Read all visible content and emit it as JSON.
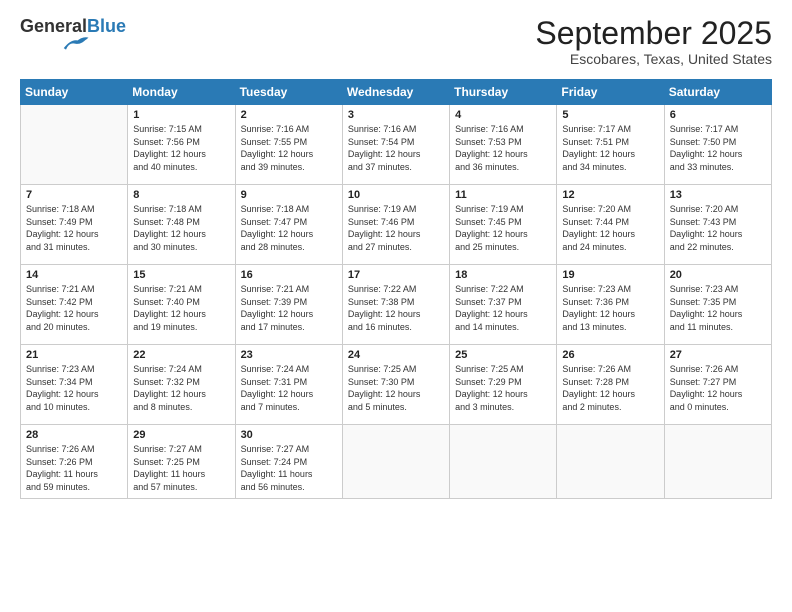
{
  "header": {
    "logo_general": "General",
    "logo_blue": "Blue",
    "month": "September 2025",
    "location": "Escobares, Texas, United States"
  },
  "weekdays": [
    "Sunday",
    "Monday",
    "Tuesday",
    "Wednesday",
    "Thursday",
    "Friday",
    "Saturday"
  ],
  "weeks": [
    [
      {
        "day": "",
        "content": ""
      },
      {
        "day": "1",
        "content": "Sunrise: 7:15 AM\nSunset: 7:56 PM\nDaylight: 12 hours\nand 40 minutes."
      },
      {
        "day": "2",
        "content": "Sunrise: 7:16 AM\nSunset: 7:55 PM\nDaylight: 12 hours\nand 39 minutes."
      },
      {
        "day": "3",
        "content": "Sunrise: 7:16 AM\nSunset: 7:54 PM\nDaylight: 12 hours\nand 37 minutes."
      },
      {
        "day": "4",
        "content": "Sunrise: 7:16 AM\nSunset: 7:53 PM\nDaylight: 12 hours\nand 36 minutes."
      },
      {
        "day": "5",
        "content": "Sunrise: 7:17 AM\nSunset: 7:51 PM\nDaylight: 12 hours\nand 34 minutes."
      },
      {
        "day": "6",
        "content": "Sunrise: 7:17 AM\nSunset: 7:50 PM\nDaylight: 12 hours\nand 33 minutes."
      }
    ],
    [
      {
        "day": "7",
        "content": "Sunrise: 7:18 AM\nSunset: 7:49 PM\nDaylight: 12 hours\nand 31 minutes."
      },
      {
        "day": "8",
        "content": "Sunrise: 7:18 AM\nSunset: 7:48 PM\nDaylight: 12 hours\nand 30 minutes."
      },
      {
        "day": "9",
        "content": "Sunrise: 7:18 AM\nSunset: 7:47 PM\nDaylight: 12 hours\nand 28 minutes."
      },
      {
        "day": "10",
        "content": "Sunrise: 7:19 AM\nSunset: 7:46 PM\nDaylight: 12 hours\nand 27 minutes."
      },
      {
        "day": "11",
        "content": "Sunrise: 7:19 AM\nSunset: 7:45 PM\nDaylight: 12 hours\nand 25 minutes."
      },
      {
        "day": "12",
        "content": "Sunrise: 7:20 AM\nSunset: 7:44 PM\nDaylight: 12 hours\nand 24 minutes."
      },
      {
        "day": "13",
        "content": "Sunrise: 7:20 AM\nSunset: 7:43 PM\nDaylight: 12 hours\nand 22 minutes."
      }
    ],
    [
      {
        "day": "14",
        "content": "Sunrise: 7:21 AM\nSunset: 7:42 PM\nDaylight: 12 hours\nand 20 minutes."
      },
      {
        "day": "15",
        "content": "Sunrise: 7:21 AM\nSunset: 7:40 PM\nDaylight: 12 hours\nand 19 minutes."
      },
      {
        "day": "16",
        "content": "Sunrise: 7:21 AM\nSunset: 7:39 PM\nDaylight: 12 hours\nand 17 minutes."
      },
      {
        "day": "17",
        "content": "Sunrise: 7:22 AM\nSunset: 7:38 PM\nDaylight: 12 hours\nand 16 minutes."
      },
      {
        "day": "18",
        "content": "Sunrise: 7:22 AM\nSunset: 7:37 PM\nDaylight: 12 hours\nand 14 minutes."
      },
      {
        "day": "19",
        "content": "Sunrise: 7:23 AM\nSunset: 7:36 PM\nDaylight: 12 hours\nand 13 minutes."
      },
      {
        "day": "20",
        "content": "Sunrise: 7:23 AM\nSunset: 7:35 PM\nDaylight: 12 hours\nand 11 minutes."
      }
    ],
    [
      {
        "day": "21",
        "content": "Sunrise: 7:23 AM\nSunset: 7:34 PM\nDaylight: 12 hours\nand 10 minutes."
      },
      {
        "day": "22",
        "content": "Sunrise: 7:24 AM\nSunset: 7:32 PM\nDaylight: 12 hours\nand 8 minutes."
      },
      {
        "day": "23",
        "content": "Sunrise: 7:24 AM\nSunset: 7:31 PM\nDaylight: 12 hours\nand 7 minutes."
      },
      {
        "day": "24",
        "content": "Sunrise: 7:25 AM\nSunset: 7:30 PM\nDaylight: 12 hours\nand 5 minutes."
      },
      {
        "day": "25",
        "content": "Sunrise: 7:25 AM\nSunset: 7:29 PM\nDaylight: 12 hours\nand 3 minutes."
      },
      {
        "day": "26",
        "content": "Sunrise: 7:26 AM\nSunset: 7:28 PM\nDaylight: 12 hours\nand 2 minutes."
      },
      {
        "day": "27",
        "content": "Sunrise: 7:26 AM\nSunset: 7:27 PM\nDaylight: 12 hours\nand 0 minutes."
      }
    ],
    [
      {
        "day": "28",
        "content": "Sunrise: 7:26 AM\nSunset: 7:26 PM\nDaylight: 11 hours\nand 59 minutes."
      },
      {
        "day": "29",
        "content": "Sunrise: 7:27 AM\nSunset: 7:25 PM\nDaylight: 11 hours\nand 57 minutes."
      },
      {
        "day": "30",
        "content": "Sunrise: 7:27 AM\nSunset: 7:24 PM\nDaylight: 11 hours\nand 56 minutes."
      },
      {
        "day": "",
        "content": ""
      },
      {
        "day": "",
        "content": ""
      },
      {
        "day": "",
        "content": ""
      },
      {
        "day": "",
        "content": ""
      }
    ]
  ]
}
